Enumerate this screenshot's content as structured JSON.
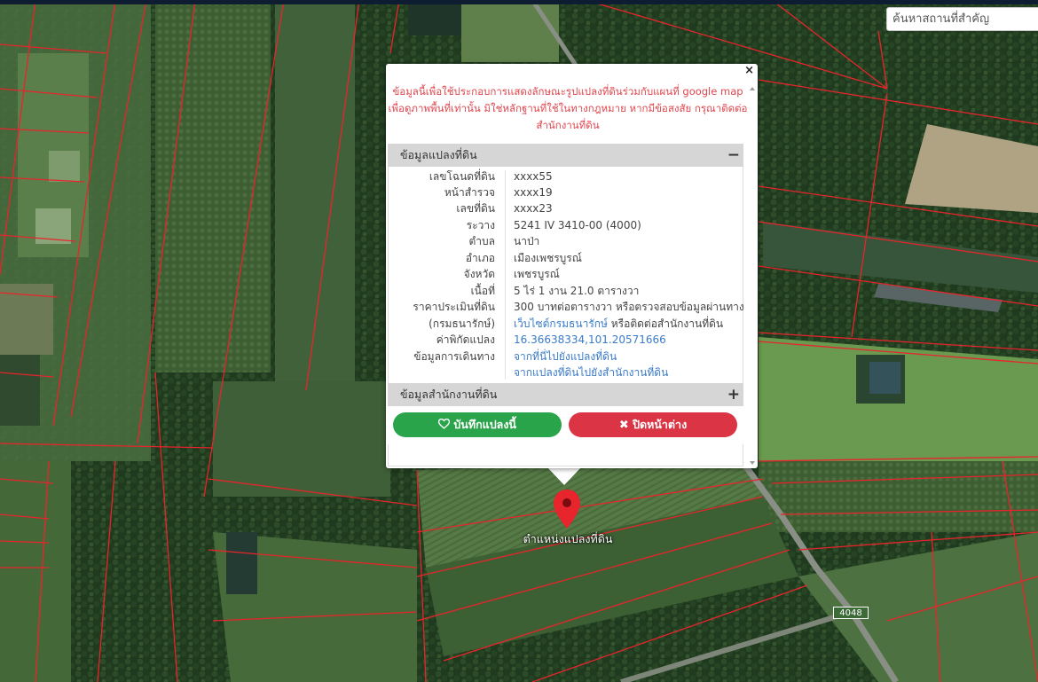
{
  "search": {
    "placeholder": "ค้นหาสถานที่สำคัญ"
  },
  "popup": {
    "close_symbol": "×",
    "disclaimer": "ข้อมูลนี้เพื่อใช้ประกอบการแสดงลักษณะรูปแปลงที่ดินร่วมกับแผนที่ google map เพื่อดูภาพพื้นที่เท่านั้น มิใช่หลักฐานที่ใช้ในทางกฎหมาย หากมีข้อสงสัย กรุณาติดต่อสำนักงานที่ดิน",
    "land_section": {
      "title": "ข้อมูลแปลงที่ดิน",
      "toggle": "−",
      "rows": [
        {
          "label": "เลขโฉนดที่ดิน",
          "value": "xxxx55"
        },
        {
          "label": "หน้าสำรวจ",
          "value": "xxxx19"
        },
        {
          "label": "เลขที่ดิน",
          "value": "xxxx23"
        },
        {
          "label": "ระวาง",
          "value": "5241 IV 3410-00 (4000)"
        },
        {
          "label": "ตำบล",
          "value": "นาป่า"
        },
        {
          "label": "อำเภอ",
          "value": "เมืองเพชรบูรณ์"
        },
        {
          "label": "จังหวัด",
          "value": "เพชรบูรณ์"
        },
        {
          "label": "เนื้อที่",
          "value": "5 ไร่ 1 งาน 21.0 ตารางวา"
        }
      ],
      "price_label": "ราคาประเมินที่ดิน",
      "price_value": "300 บาทต่อตารางวา หรือตรวจสอบข้อมูลผ่านทาง",
      "price_label2": "(กรมธนารักษ์)",
      "price_link": "เว็บไซต์กรมธนารักษ์",
      "price_suffix": " หรือติดต่อสำนักงานที่ดิน",
      "coord_label": "ค่าพิกัดแปลง",
      "coord_value": "16.36638334,101.20571666",
      "travel_label": "ข้อมูลการเดินทาง",
      "travel_link1": "จากที่นี่ไปยังแปลงที่ดิน",
      "travel_link2": "จากแปลงที่ดินไปยังสำนักงานที่ดิน"
    },
    "office_section": {
      "title": "ข้อมูลสำนักงานที่ดิน",
      "toggle": "+"
    },
    "save_button": "บันทึกแปลงนี้",
    "close_button": "ปิดหน้าต่าง"
  },
  "marker": {
    "label": "ตำแหน่งแปลงที่ดิน"
  },
  "road": {
    "number": "4048"
  },
  "colors": {
    "parcel_line": "#e8242c",
    "marker": "#e8242c",
    "save": "#2aa44a",
    "close": "#db3545"
  }
}
